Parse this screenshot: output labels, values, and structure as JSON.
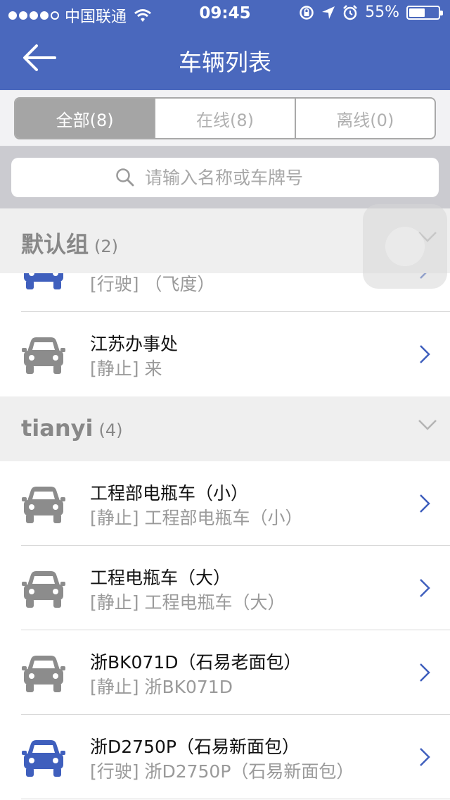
{
  "status_bar": {
    "carrier": "中国联通",
    "time": "09:45",
    "battery": "55%",
    "battery_level": 0.55
  },
  "nav": {
    "title": "车辆列表",
    "back_icon": "back-arrow-icon"
  },
  "segments": [
    {
      "label": "全部(8)",
      "active": true
    },
    {
      "label": "在线(8)",
      "active": false
    },
    {
      "label": "离线(0)",
      "active": false
    }
  ],
  "search": {
    "placeholder": "请输入名称或车牌号",
    "value": ""
  },
  "groups": [
    {
      "name": "默认组",
      "count": "(2)",
      "vehicles": [
        {
          "name": "",
          "status_line": "[行驶] （飞度）",
          "state": "moving"
        },
        {
          "name": "江苏办事处",
          "status_line": "[静止] 来",
          "state": "stopped"
        }
      ]
    },
    {
      "name": "tianyi",
      "count": "(4)",
      "vehicles": [
        {
          "name": "工程部电瓶车（小）",
          "status_line": "[静止] 工程部电瓶车（小）",
          "state": "stopped"
        },
        {
          "name": "工程电瓶车（大）",
          "status_line": "[静止] 工程电瓶车（大）",
          "state": "stopped"
        },
        {
          "name": "浙BK071D（石易老面包）",
          "status_line": "[静止] 浙BK071D",
          "state": "stopped"
        },
        {
          "name": "浙D2750P（石易新面包）",
          "status_line": "[行驶] 浙D2750P（石易新面包）",
          "state": "moving"
        }
      ]
    }
  ],
  "colors": {
    "header": "#4a68bd",
    "moving_car": "#3f5fbd",
    "stopped_car": "#8c8c8c",
    "chevron": "#3f5fbd"
  }
}
